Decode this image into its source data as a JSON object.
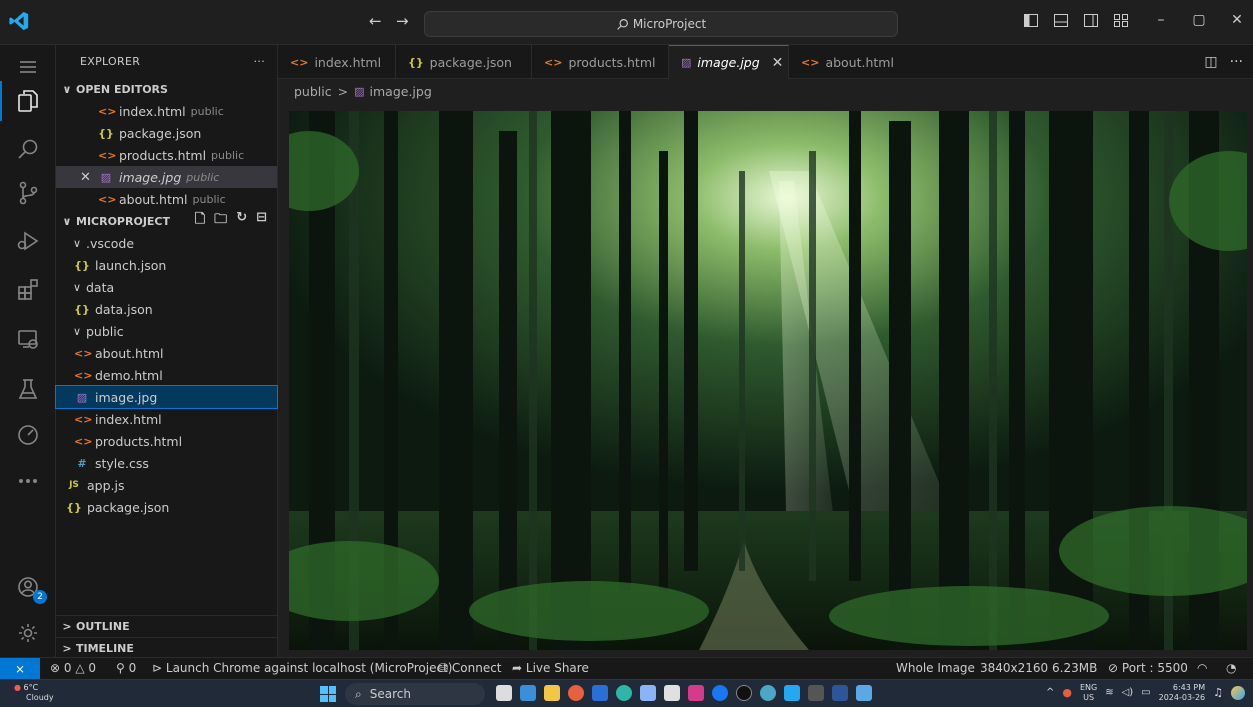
{
  "titlebar": {
    "search_text": "MicroProject"
  },
  "sidebar": {
    "title": "EXPLORER",
    "open_editors": {
      "label": "OPEN EDITORS",
      "items": [
        {
          "name": "index.html",
          "desc": "public",
          "icon": "html-icon"
        },
        {
          "name": "package.json",
          "desc": "",
          "icon": "json-icon"
        },
        {
          "name": "products.html",
          "desc": "public",
          "icon": "html-icon"
        },
        {
          "name": "image.jpg",
          "desc": "public",
          "icon": "image-icon"
        },
        {
          "name": "about.html",
          "desc": "public",
          "icon": "html-icon"
        }
      ]
    },
    "project": {
      "label": "MICROPROJECT",
      "tree": [
        {
          "name": ".vscode"
        },
        {
          "name": "launch.json"
        },
        {
          "name": "data"
        },
        {
          "name": "data.json"
        },
        {
          "name": "public"
        },
        {
          "name": "about.html"
        },
        {
          "name": "demo.html"
        },
        {
          "name": "image.jpg"
        },
        {
          "name": "index.html"
        },
        {
          "name": "products.html"
        },
        {
          "name": "style.css"
        },
        {
          "name": "app.js"
        },
        {
          "name": "package.json"
        }
      ]
    },
    "outline_label": "OUTLINE",
    "timeline_label": "TIMELINE"
  },
  "tabs": [
    {
      "label": "index.html"
    },
    {
      "label": "package.json"
    },
    {
      "label": "products.html"
    },
    {
      "label": "image.jpg"
    },
    {
      "label": "about.html"
    }
  ],
  "breadcrumb": {
    "folder": "public",
    "file": "image.jpg"
  },
  "activitybar": {
    "accounts_badge": "2"
  },
  "statusbar": {
    "errors": "0",
    "warnings": "0",
    "ports": "0",
    "launch": "Launch Chrome against localhost (MicroProject)",
    "connect": "Connect",
    "live_share": "Live Share",
    "image_mode": "Whole Image",
    "dimensions": "3840x2160",
    "size": "6.23MB",
    "port": "Port : 5500"
  },
  "taskbar": {
    "temperature": "6°C",
    "weather": "Cloudy",
    "search": "Search",
    "lang": "ENG",
    "region": "US",
    "time": "6:43 PM",
    "date": "2024-03-26"
  },
  "colors": {
    "accent": "#0078d4",
    "html": "#e37933",
    "json": "#cbcb41",
    "css": "#519aba",
    "image": "#a074c4"
  }
}
